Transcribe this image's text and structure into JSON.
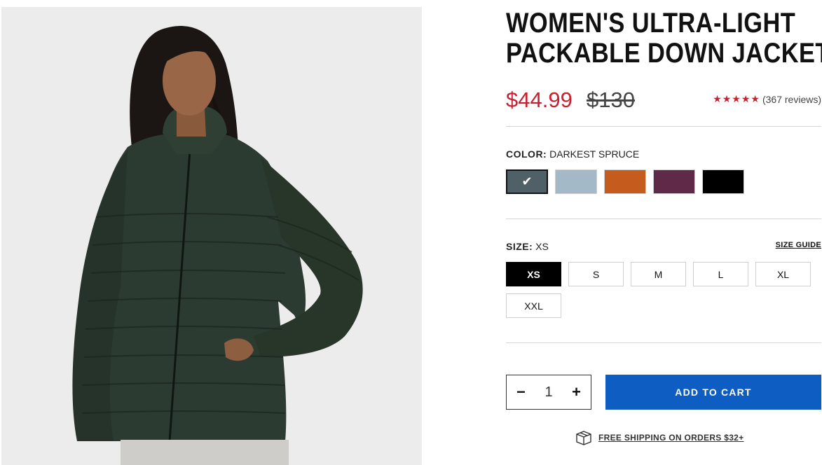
{
  "product": {
    "title_line1": "WOMEN'S ULTRA-LIGHT",
    "title_line2": "PACKABLE DOWN JACKET",
    "price_sale": "$44.99",
    "price_original": "$130",
    "stars": "★★★★★",
    "rating": 5,
    "reviews_text": "(367 reviews)"
  },
  "color": {
    "label": "COLOR:",
    "selected_name": "DARKEST SPRUCE",
    "options": [
      {
        "name": "darkest-spruce",
        "hex": "#4f6066",
        "selected": true
      },
      {
        "name": "light-blue",
        "hex": "#a3b9c8",
        "selected": false
      },
      {
        "name": "orange",
        "hex": "#c55c1d",
        "selected": false
      },
      {
        "name": "plum",
        "hex": "#5e2a47",
        "selected": false
      },
      {
        "name": "black",
        "hex": "#000000",
        "selected": false
      }
    ],
    "check_icon": "✔"
  },
  "size": {
    "label": "SIZE:",
    "selected": "XS",
    "guide_label": "SIZE GUIDE",
    "options": [
      "XS",
      "S",
      "M",
      "L",
      "XL",
      "XXL"
    ]
  },
  "cart": {
    "minus_label": "−",
    "quantity": "1",
    "plus_label": "+",
    "add_label": "ADD TO CART",
    "accent_color": "#0d5dc2"
  },
  "shipping": {
    "icon": "box-icon",
    "text": "FREE SHIPPING ON ORDERS $32+"
  },
  "colors": {
    "sale_price": "#c8202f",
    "jacket": "#2c3b31"
  }
}
